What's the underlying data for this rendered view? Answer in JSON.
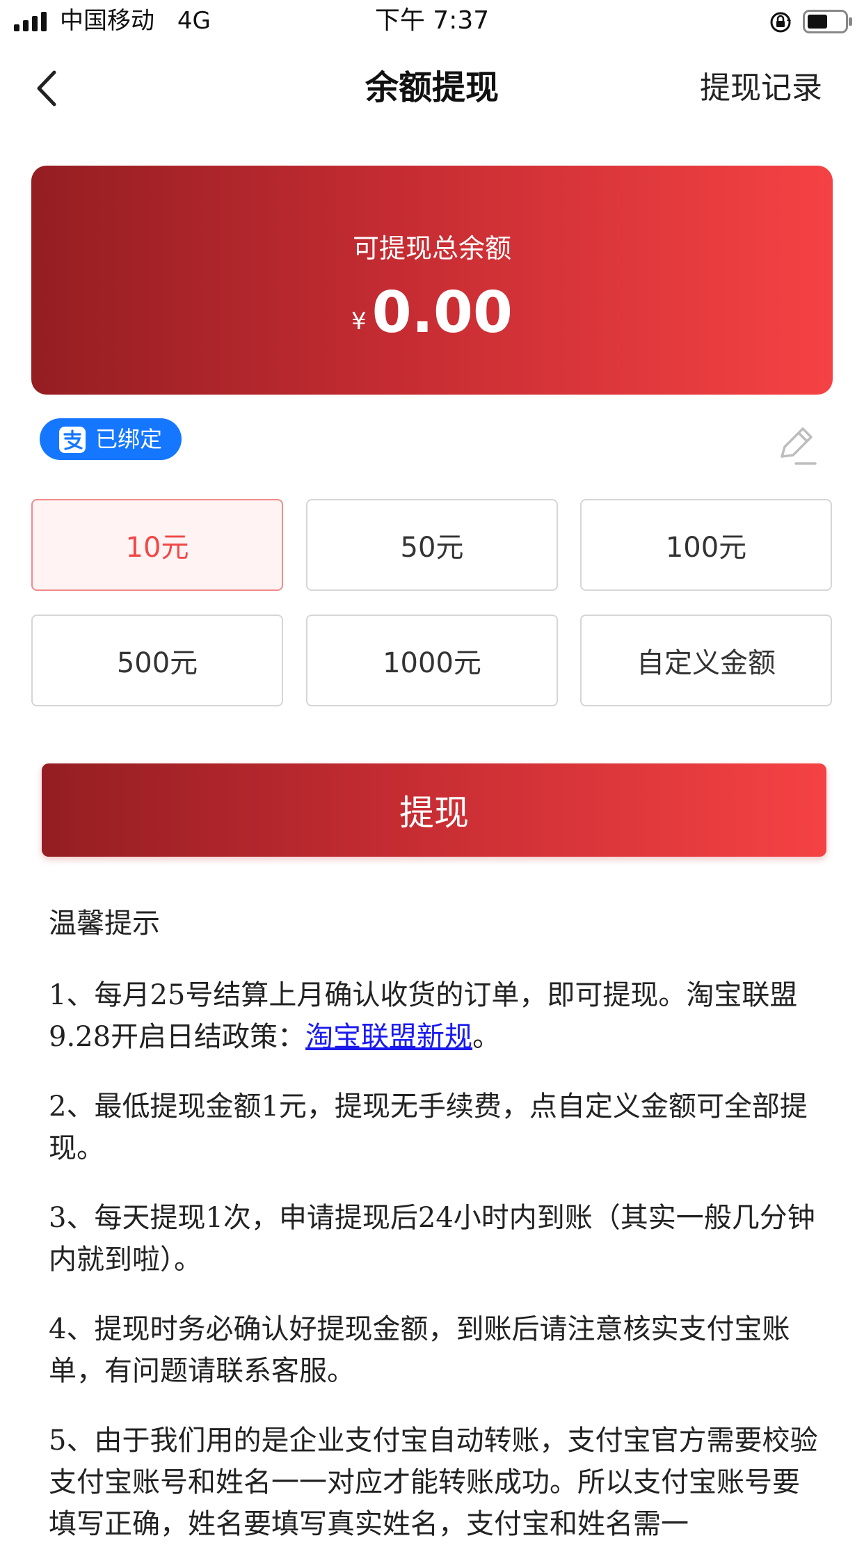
{
  "status_bar": {
    "carrier": "中国移动",
    "network": "4G",
    "time": "下午 7:37"
  },
  "nav": {
    "title": "余额提现",
    "right_label": "提现记录"
  },
  "balance": {
    "label": "可提现总余额",
    "currency_symbol": "¥",
    "amount": "0.00"
  },
  "account": {
    "bound_label": "已绑定"
  },
  "amount_options": [
    {
      "label": "10元",
      "selected": true
    },
    {
      "label": "50元",
      "selected": false
    },
    {
      "label": "100元",
      "selected": false
    },
    {
      "label": "500元",
      "selected": false
    },
    {
      "label": "1000元",
      "selected": false
    },
    {
      "label": "自定义金额",
      "selected": false
    }
  ],
  "withdraw_button_label": "提现",
  "tips": {
    "title": "温馨提示",
    "items": [
      {
        "before": "1、每月25号结算上月确认收货的订单，即可提现。淘宝联盟9.28开启日结政策：",
        "link": "淘宝联盟新规",
        "after": "。"
      },
      {
        "text": "2、最低提现金额1元，提现无手续费，点自定义金额可全部提现。"
      },
      {
        "text": "3、每天提现1次，申请提现后24小时内到账（其实一般几分钟内就到啦）。"
      },
      {
        "text": "4、提现时务必确认好提现金额，到账后请注意核实支付宝账单，有问题请联系客服。"
      },
      {
        "text": "5、由于我们用的是企业支付宝自动转账，支付宝官方需要校验支付宝账号和姓名一一对应才能转账成功。所以支付宝账号要填写正确，姓名要填写真实姓名，支付宝和姓名需一"
      }
    ]
  },
  "colors": {
    "accent_dark": "#941e22",
    "accent_light": "#f54244",
    "alipay_blue": "#1577ff",
    "selected_text": "#f04848",
    "link": "#1a1aee"
  },
  "icons": {
    "signal": "signal-bars-icon",
    "lock": "orientation-lock-icon",
    "battery": "battery-icon",
    "back": "chevron-left-icon",
    "alipay": "alipay-icon",
    "edit": "edit-pencil-icon"
  }
}
